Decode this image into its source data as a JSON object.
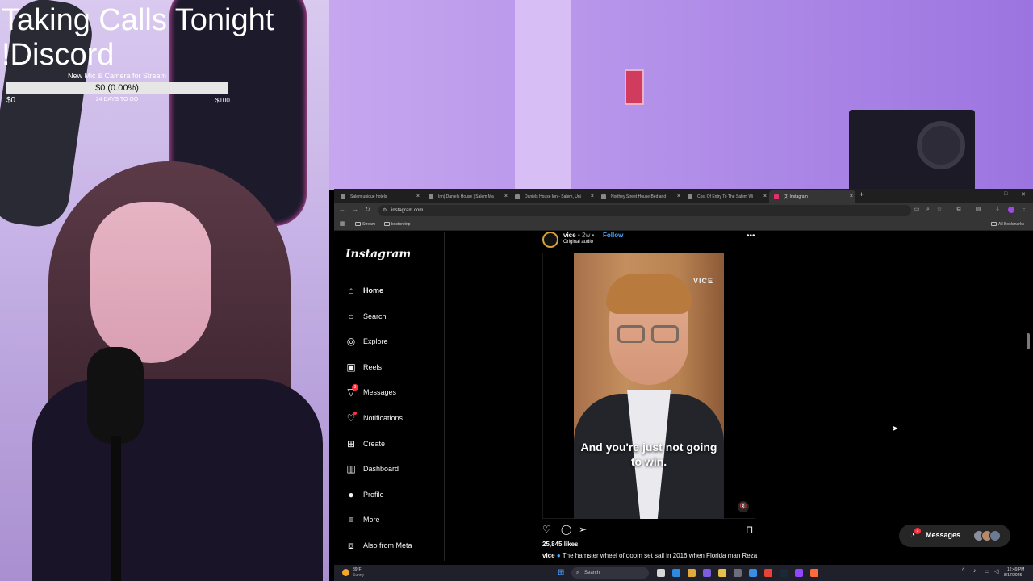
{
  "overlay": {
    "title": "Taking Calls Tonight !Discord",
    "goal_name": "New Mic & Camera for Stream",
    "goal_amount": "$0 (0.00%)",
    "goal_progress": 0.0,
    "goal_min": "$0",
    "goal_days": "24 DAYS TO GO",
    "goal_max": "$100"
  },
  "browser": {
    "tabs": [
      {
        "title": "Salem unique hotels",
        "active": false
      },
      {
        "title": "Inn| Daniels House | Salem Ma",
        "active": false
      },
      {
        "title": "Daniels House Inn - Salem, Uni",
        "active": false
      },
      {
        "title": "Northey Street House Bed and",
        "active": false
      },
      {
        "title": "Cost Of Entry To The Salem Wi",
        "active": false
      },
      {
        "title": "(3) Instagram",
        "active": true
      }
    ],
    "url": "instagram.com",
    "bookmarks": [
      "Stream",
      "boston trip"
    ],
    "all_bookmarks": "All Bookmarks"
  },
  "instagram": {
    "logo": "Instagram",
    "nav": [
      {
        "label": "Home",
        "icon": "home-icon",
        "active": true
      },
      {
        "label": "Search",
        "icon": "search-icon"
      },
      {
        "label": "Explore",
        "icon": "compass-icon"
      },
      {
        "label": "Reels",
        "icon": "reels-icon"
      },
      {
        "label": "Messages",
        "icon": "messenger-icon",
        "badge": "3"
      },
      {
        "label": "Notifications",
        "icon": "heart-icon",
        "dot": true
      },
      {
        "label": "Create",
        "icon": "plus-square-icon"
      },
      {
        "label": "Dashboard",
        "icon": "dashboard-icon"
      },
      {
        "label": "Profile",
        "icon": "avatar-icon"
      },
      {
        "label": "More",
        "icon": "menu-icon"
      },
      {
        "label": "Also from Meta",
        "icon": "meta-icon"
      }
    ],
    "post": {
      "username": "vice",
      "meta": "• 2w •",
      "follow": "Follow",
      "audio": "Original audio",
      "watermark": "VICE",
      "video_caption": "And you're just not going to win.",
      "likes": "25,845 likes",
      "caption_user": "vice",
      "caption_text": "The hamster wheel of doom set sail in 2016 when Florida man Reza"
    },
    "messages_pill": {
      "label": "Messages",
      "badge": "3"
    }
  },
  "taskbar": {
    "weather_temp": "89°F",
    "weather_cond": "Sunny",
    "search": "Search",
    "time": "12:49 PM",
    "date": "8/17/2025"
  },
  "colors": {
    "instagram_bg": "#000000",
    "notification_red": "#ff3040",
    "follow_blue": "#4aa7ff",
    "goal_fill": "#7a3fbf"
  }
}
